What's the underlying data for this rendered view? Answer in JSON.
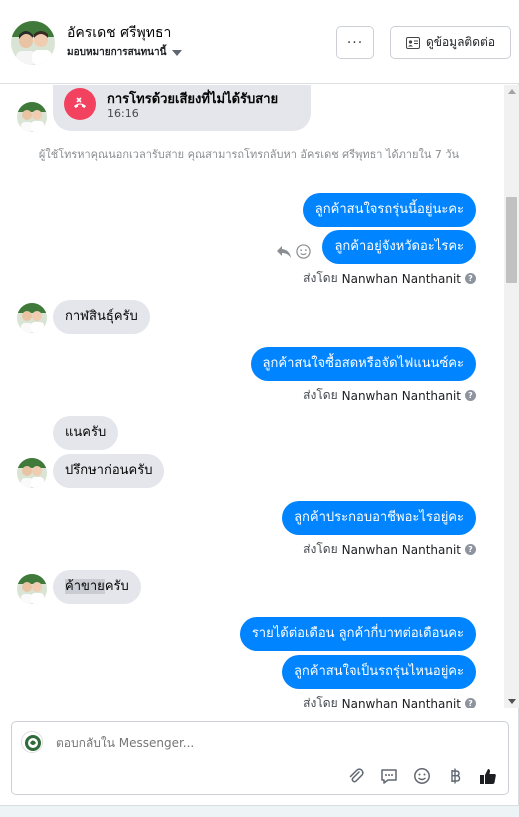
{
  "header": {
    "name": "อัครเดช ศรีพุทธา",
    "assigned": "มอบหมายการสนทนานี้",
    "more_label": "···",
    "contact_label": "ดูข้อมูลติดต่อ"
  },
  "call": {
    "title": "การโทรด้วยเสียงที่ไม่ได้รับสาย",
    "time": "16:16"
  },
  "notice": "ผู้ใช้โทรหาคุณนอกเวลารับสาย คุณสามารถโทรกลับหา อัครเดช ศรีพุทธา ได้ภายใน 7 วัน",
  "sent_by_prefix": "ส่งโดย",
  "sent_by_name": "Nanwhan Nanthanit",
  "messages": {
    "out1": "ลูกค้าสนใจรถรุ่นนี้อยู่นะคะ",
    "out2": "ลูกค้าอยู่จังหวัดอะไรคะ",
    "in1": "กาฬสินธุ์ครับ",
    "out3": "ลูกค้าสนใจซื้อสดหรือจัดไฟแนนซ์คะ",
    "in2": "แนครับ",
    "in3": "ปรึกษาก่อนครับ",
    "out4": "ลูกค้าประกอบอาชีพอะไรอยู่คะ",
    "in4_highlight": "ค้าขาย",
    "in4_rest": "ครับ",
    "out5": "รายได้ต่อเดือน ลูกค้ากี่บาทต่อเดือนคะ",
    "out6": "ลูกค้าสนใจเป็นรถรุ่นไหนอยู่คะ"
  },
  "composer": {
    "placeholder": "ตอบกลับใน Messenger..."
  },
  "icons": {
    "more": "more-icon",
    "contact": "contact-card-icon",
    "call": "missed-call-icon",
    "reply": "reply-icon",
    "react": "smiley-icon",
    "help": "help-icon",
    "attach": "paperclip-icon",
    "saved_reply": "saved-reply-icon",
    "emoji": "emoji-icon",
    "baht": "baht-icon",
    "like": "thumbs-up-icon"
  },
  "colors": {
    "outgoing_bubble": "#0084ff",
    "incoming_bubble": "#e4e6eb",
    "missed_call": "#f3425f"
  }
}
